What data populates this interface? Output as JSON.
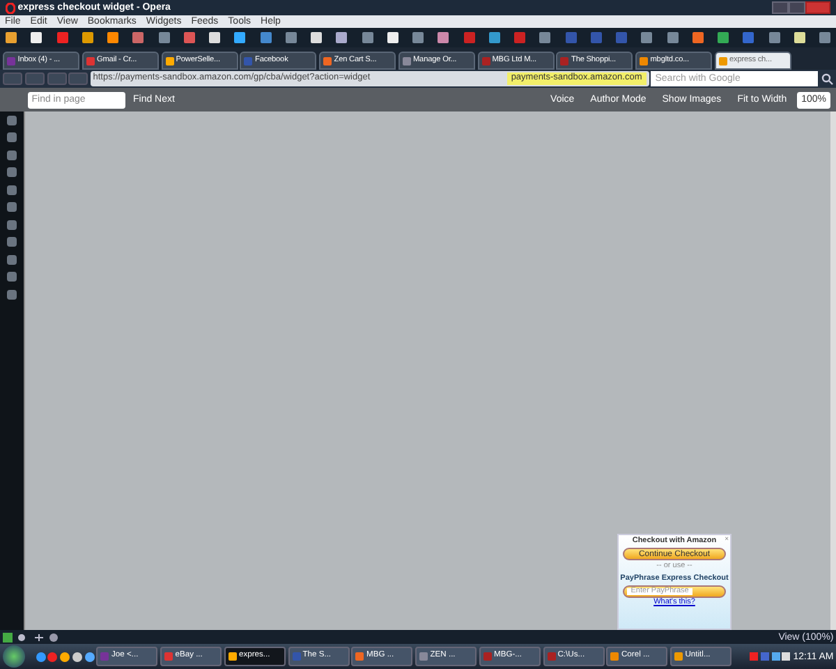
{
  "window": {
    "title": "express checkout widget - Opera"
  },
  "menu": [
    "File",
    "Edit",
    "View",
    "Bookmarks",
    "Widgets",
    "Feeds",
    "Tools",
    "Help"
  ],
  "tabs": [
    {
      "label": "Inbox (4) - ...",
      "selected": false
    },
    {
      "label": "Gmail - Cr...",
      "selected": false
    },
    {
      "label": "PowerSelle...",
      "selected": false
    },
    {
      "label": "Facebook",
      "selected": false
    },
    {
      "label": "Zen Cart S...",
      "selected": false
    },
    {
      "label": "Manage Or...",
      "selected": false
    },
    {
      "label": "MBG Ltd M...",
      "selected": false
    },
    {
      "label": "The Shoppi...",
      "selected": false
    },
    {
      "label": "mbgltd.co...",
      "selected": false
    },
    {
      "label": "express ch...",
      "selected": true
    }
  ],
  "address": {
    "url": "https://payments-sandbox.amazon.com/gp/cba/widget?action=widget",
    "domain": "payments-sandbox.amazon.com",
    "search_placeholder": "Search with Google"
  },
  "find_bar": {
    "placeholder": "Find in page",
    "find_next": "Find Next",
    "voice": "Voice",
    "author_mode": "Author Mode",
    "show_images": "Show Images",
    "fit_to_width": "Fit to Width",
    "zoom": "100%"
  },
  "widget": {
    "title": "Checkout with Amazon",
    "close": "×",
    "continue": "Continue Checkout",
    "or_use": "-- or use --",
    "payphrase_title": "PayPhrase Express Checkout",
    "payphrase_placeholder": "Enter PayPhrase",
    "whats_this": "What's this?"
  },
  "status_bar": {
    "view": "View (100%)"
  },
  "taskbar": [
    {
      "label": "Joe <...",
      "selected": false
    },
    {
      "label": "eBay ...",
      "selected": false
    },
    {
      "label": "expres...",
      "selected": true
    },
    {
      "label": "The S...",
      "selected": false
    },
    {
      "label": "MBG ...",
      "selected": false
    },
    {
      "label": "ZEN ...",
      "selected": false
    },
    {
      "label": "MBG-...",
      "selected": false
    },
    {
      "label": "C:\\Us...",
      "selected": false
    },
    {
      "label": "Corel ...",
      "selected": false
    },
    {
      "label": "Untitl...",
      "selected": false
    }
  ],
  "clock": "12:11 AM"
}
